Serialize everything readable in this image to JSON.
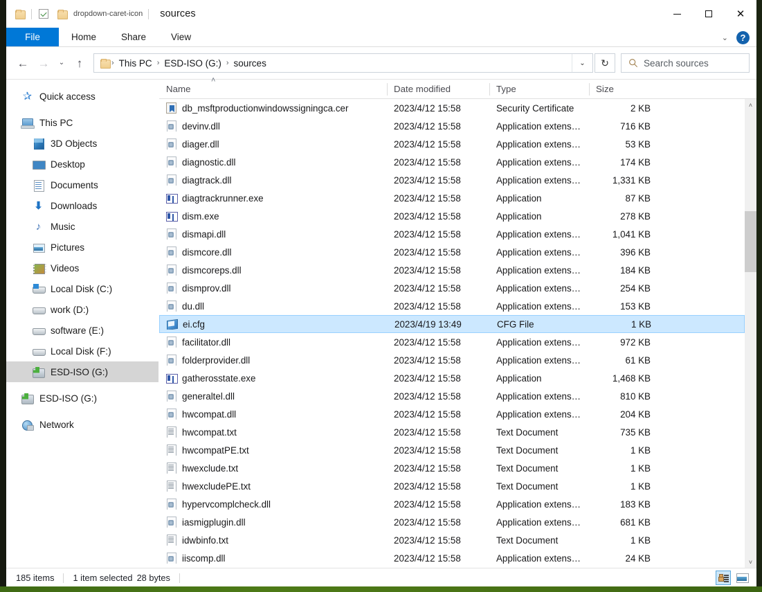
{
  "window": {
    "title": "sources",
    "quick_access_icons": [
      "folder-icon",
      "checkbox-icon",
      "folder-icon",
      "dropdown-caret-icon"
    ],
    "minimize_label": "—",
    "maximize_label": "",
    "close_label": "✕"
  },
  "ribbon": {
    "tabs": [
      {
        "label": "File",
        "active": true
      },
      {
        "label": "Home",
        "active": false
      },
      {
        "label": "Share",
        "active": false
      },
      {
        "label": "View",
        "active": false
      }
    ],
    "collapse_caret": "⌄",
    "help_label": "?"
  },
  "address": {
    "back_glyph": "←",
    "forward_glyph": "→",
    "recent_glyph": "⌄",
    "up_glyph": "↑",
    "crumbs": [
      "This PC",
      "ESD-ISO (G:)",
      "sources"
    ],
    "crumb_sep": "›",
    "dropdown_glyph": "⌄",
    "refresh_glyph": "↻"
  },
  "search": {
    "placeholder": "Search sources",
    "icon": "search-icon"
  },
  "navpane": {
    "items": [
      {
        "label": "Quick access",
        "icon": "star-icon",
        "level": 0,
        "gap": false,
        "selected": false
      },
      {
        "label": "This PC",
        "icon": "this-pc-icon",
        "level": 0,
        "gap": true,
        "selected": false
      },
      {
        "label": "3D Objects",
        "icon": "3d-objects-icon",
        "level": 1,
        "gap": false,
        "selected": false
      },
      {
        "label": "Desktop",
        "icon": "desktop-icon",
        "level": 1,
        "gap": false,
        "selected": false
      },
      {
        "label": "Documents",
        "icon": "documents-icon",
        "level": 1,
        "gap": false,
        "selected": false
      },
      {
        "label": "Downloads",
        "icon": "downloads-icon",
        "level": 1,
        "gap": false,
        "selected": false
      },
      {
        "label": "Music",
        "icon": "music-icon",
        "level": 1,
        "gap": false,
        "selected": false
      },
      {
        "label": "Pictures",
        "icon": "pictures-icon",
        "level": 1,
        "gap": false,
        "selected": false
      },
      {
        "label": "Videos",
        "icon": "videos-icon",
        "level": 1,
        "gap": false,
        "selected": false
      },
      {
        "label": "Local Disk (C:)",
        "icon": "windows-disk-icon",
        "level": 1,
        "gap": false,
        "selected": false
      },
      {
        "label": "work (D:)",
        "icon": "disk-icon",
        "level": 1,
        "gap": false,
        "selected": false
      },
      {
        "label": "software (E:)",
        "icon": "disk-icon",
        "level": 1,
        "gap": false,
        "selected": false
      },
      {
        "label": "Local Disk (F:)",
        "icon": "disk-icon",
        "level": 1,
        "gap": false,
        "selected": false
      },
      {
        "label": "ESD-ISO (G:)",
        "icon": "cd-drive-icon",
        "level": 1,
        "gap": false,
        "selected": true
      },
      {
        "label": "ESD-ISO (G:)",
        "icon": "cd-drive-icon",
        "level": 0,
        "gap": true,
        "selected": false
      },
      {
        "label": "Network",
        "icon": "network-icon",
        "level": 0,
        "gap": true,
        "selected": false
      }
    ]
  },
  "filelist": {
    "columns": [
      "Name",
      "Date modified",
      "Type",
      "Size"
    ],
    "sort_column": "Name",
    "sort_indicator": "˄",
    "rows": [
      {
        "name": "db_msftproductionwindowssigningca.cer",
        "date": "2023/4/12 15:58",
        "type": "Security Certificate",
        "size": "2 KB",
        "icon": "certificate-file-icon",
        "selected": false
      },
      {
        "name": "devinv.dll",
        "date": "2023/4/12 15:58",
        "type": "Application extens…",
        "size": "716 KB",
        "icon": "dll-file-icon",
        "selected": false
      },
      {
        "name": "diager.dll",
        "date": "2023/4/12 15:58",
        "type": "Application extens…",
        "size": "53 KB",
        "icon": "dll-file-icon",
        "selected": false
      },
      {
        "name": "diagnostic.dll",
        "date": "2023/4/12 15:58",
        "type": "Application extens…",
        "size": "174 KB",
        "icon": "dll-file-icon",
        "selected": false
      },
      {
        "name": "diagtrack.dll",
        "date": "2023/4/12 15:58",
        "type": "Application extens…",
        "size": "1,331 KB",
        "icon": "dll-file-icon",
        "selected": false
      },
      {
        "name": "diagtrackrunner.exe",
        "date": "2023/4/12 15:58",
        "type": "Application",
        "size": "87 KB",
        "icon": "exe-file-icon",
        "selected": false
      },
      {
        "name": "dism.exe",
        "date": "2023/4/12 15:58",
        "type": "Application",
        "size": "278 KB",
        "icon": "exe-file-icon",
        "selected": false
      },
      {
        "name": "dismapi.dll",
        "date": "2023/4/12 15:58",
        "type": "Application extens…",
        "size": "1,041 KB",
        "icon": "dll-file-icon",
        "selected": false
      },
      {
        "name": "dismcore.dll",
        "date": "2023/4/12 15:58",
        "type": "Application extens…",
        "size": "396 KB",
        "icon": "dll-file-icon",
        "selected": false
      },
      {
        "name": "dismcoreps.dll",
        "date": "2023/4/12 15:58",
        "type": "Application extens…",
        "size": "184 KB",
        "icon": "dll-file-icon",
        "selected": false
      },
      {
        "name": "dismprov.dll",
        "date": "2023/4/12 15:58",
        "type": "Application extens…",
        "size": "254 KB",
        "icon": "dll-file-icon",
        "selected": false
      },
      {
        "name": "du.dll",
        "date": "2023/4/12 15:58",
        "type": "Application extens…",
        "size": "153 KB",
        "icon": "dll-file-icon",
        "selected": false
      },
      {
        "name": "ei.cfg",
        "date": "2023/4/19 13:49",
        "type": "CFG File",
        "size": "1 KB",
        "icon": "cfg-file-icon",
        "selected": true
      },
      {
        "name": "facilitator.dll",
        "date": "2023/4/12 15:58",
        "type": "Application extens…",
        "size": "972 KB",
        "icon": "dll-file-icon",
        "selected": false
      },
      {
        "name": "folderprovider.dll",
        "date": "2023/4/12 15:58",
        "type": "Application extens…",
        "size": "61 KB",
        "icon": "dll-file-icon",
        "selected": false
      },
      {
        "name": "gatherosstate.exe",
        "date": "2023/4/12 15:58",
        "type": "Application",
        "size": "1,468 KB",
        "icon": "exe-file-icon",
        "selected": false
      },
      {
        "name": "generaltel.dll",
        "date": "2023/4/12 15:58",
        "type": "Application extens…",
        "size": "810 KB",
        "icon": "dll-file-icon",
        "selected": false
      },
      {
        "name": "hwcompat.dll",
        "date": "2023/4/12 15:58",
        "type": "Application extens…",
        "size": "204 KB",
        "icon": "dll-file-icon",
        "selected": false
      },
      {
        "name": "hwcompat.txt",
        "date": "2023/4/12 15:58",
        "type": "Text Document",
        "size": "735 KB",
        "icon": "txt-file-icon",
        "selected": false
      },
      {
        "name": "hwcompatPE.txt",
        "date": "2023/4/12 15:58",
        "type": "Text Document",
        "size": "1 KB",
        "icon": "txt-file-icon",
        "selected": false
      },
      {
        "name": "hwexclude.txt",
        "date": "2023/4/12 15:58",
        "type": "Text Document",
        "size": "1 KB",
        "icon": "txt-file-icon",
        "selected": false
      },
      {
        "name": "hwexcludePE.txt",
        "date": "2023/4/12 15:58",
        "type": "Text Document",
        "size": "1 KB",
        "icon": "txt-file-icon",
        "selected": false
      },
      {
        "name": "hypervcomplcheck.dll",
        "date": "2023/4/12 15:58",
        "type": "Application extens…",
        "size": "183 KB",
        "icon": "dll-file-icon",
        "selected": false
      },
      {
        "name": "iasmigplugin.dll",
        "date": "2023/4/12 15:58",
        "type": "Application extens…",
        "size": "681 KB",
        "icon": "dll-file-icon",
        "selected": false
      },
      {
        "name": "idwbinfo.txt",
        "date": "2023/4/12 15:58",
        "type": "Text Document",
        "size": "1 KB",
        "icon": "txt-file-icon",
        "selected": false
      },
      {
        "name": "iiscomp.dll",
        "date": "2023/4/12 15:58",
        "type": "Application extens…",
        "size": "24 KB",
        "icon": "dll-file-icon",
        "selected": false
      }
    ]
  },
  "scrollbar": {
    "up_glyph": "˄",
    "down_glyph": "˅",
    "thumb_top_pct": 24,
    "thumb_height_pct": 13
  },
  "statusbar": {
    "item_count": "185 items",
    "selection": "1 item selected",
    "selection_size": "28 bytes",
    "views": [
      {
        "name": "details-view",
        "active": true
      },
      {
        "name": "large-icons-view",
        "active": false
      }
    ]
  },
  "colors": {
    "accent": "#0078d7",
    "selection": "#cce8ff",
    "nav_selection": "#d5d5d5",
    "help_blue": "#1362ad"
  }
}
